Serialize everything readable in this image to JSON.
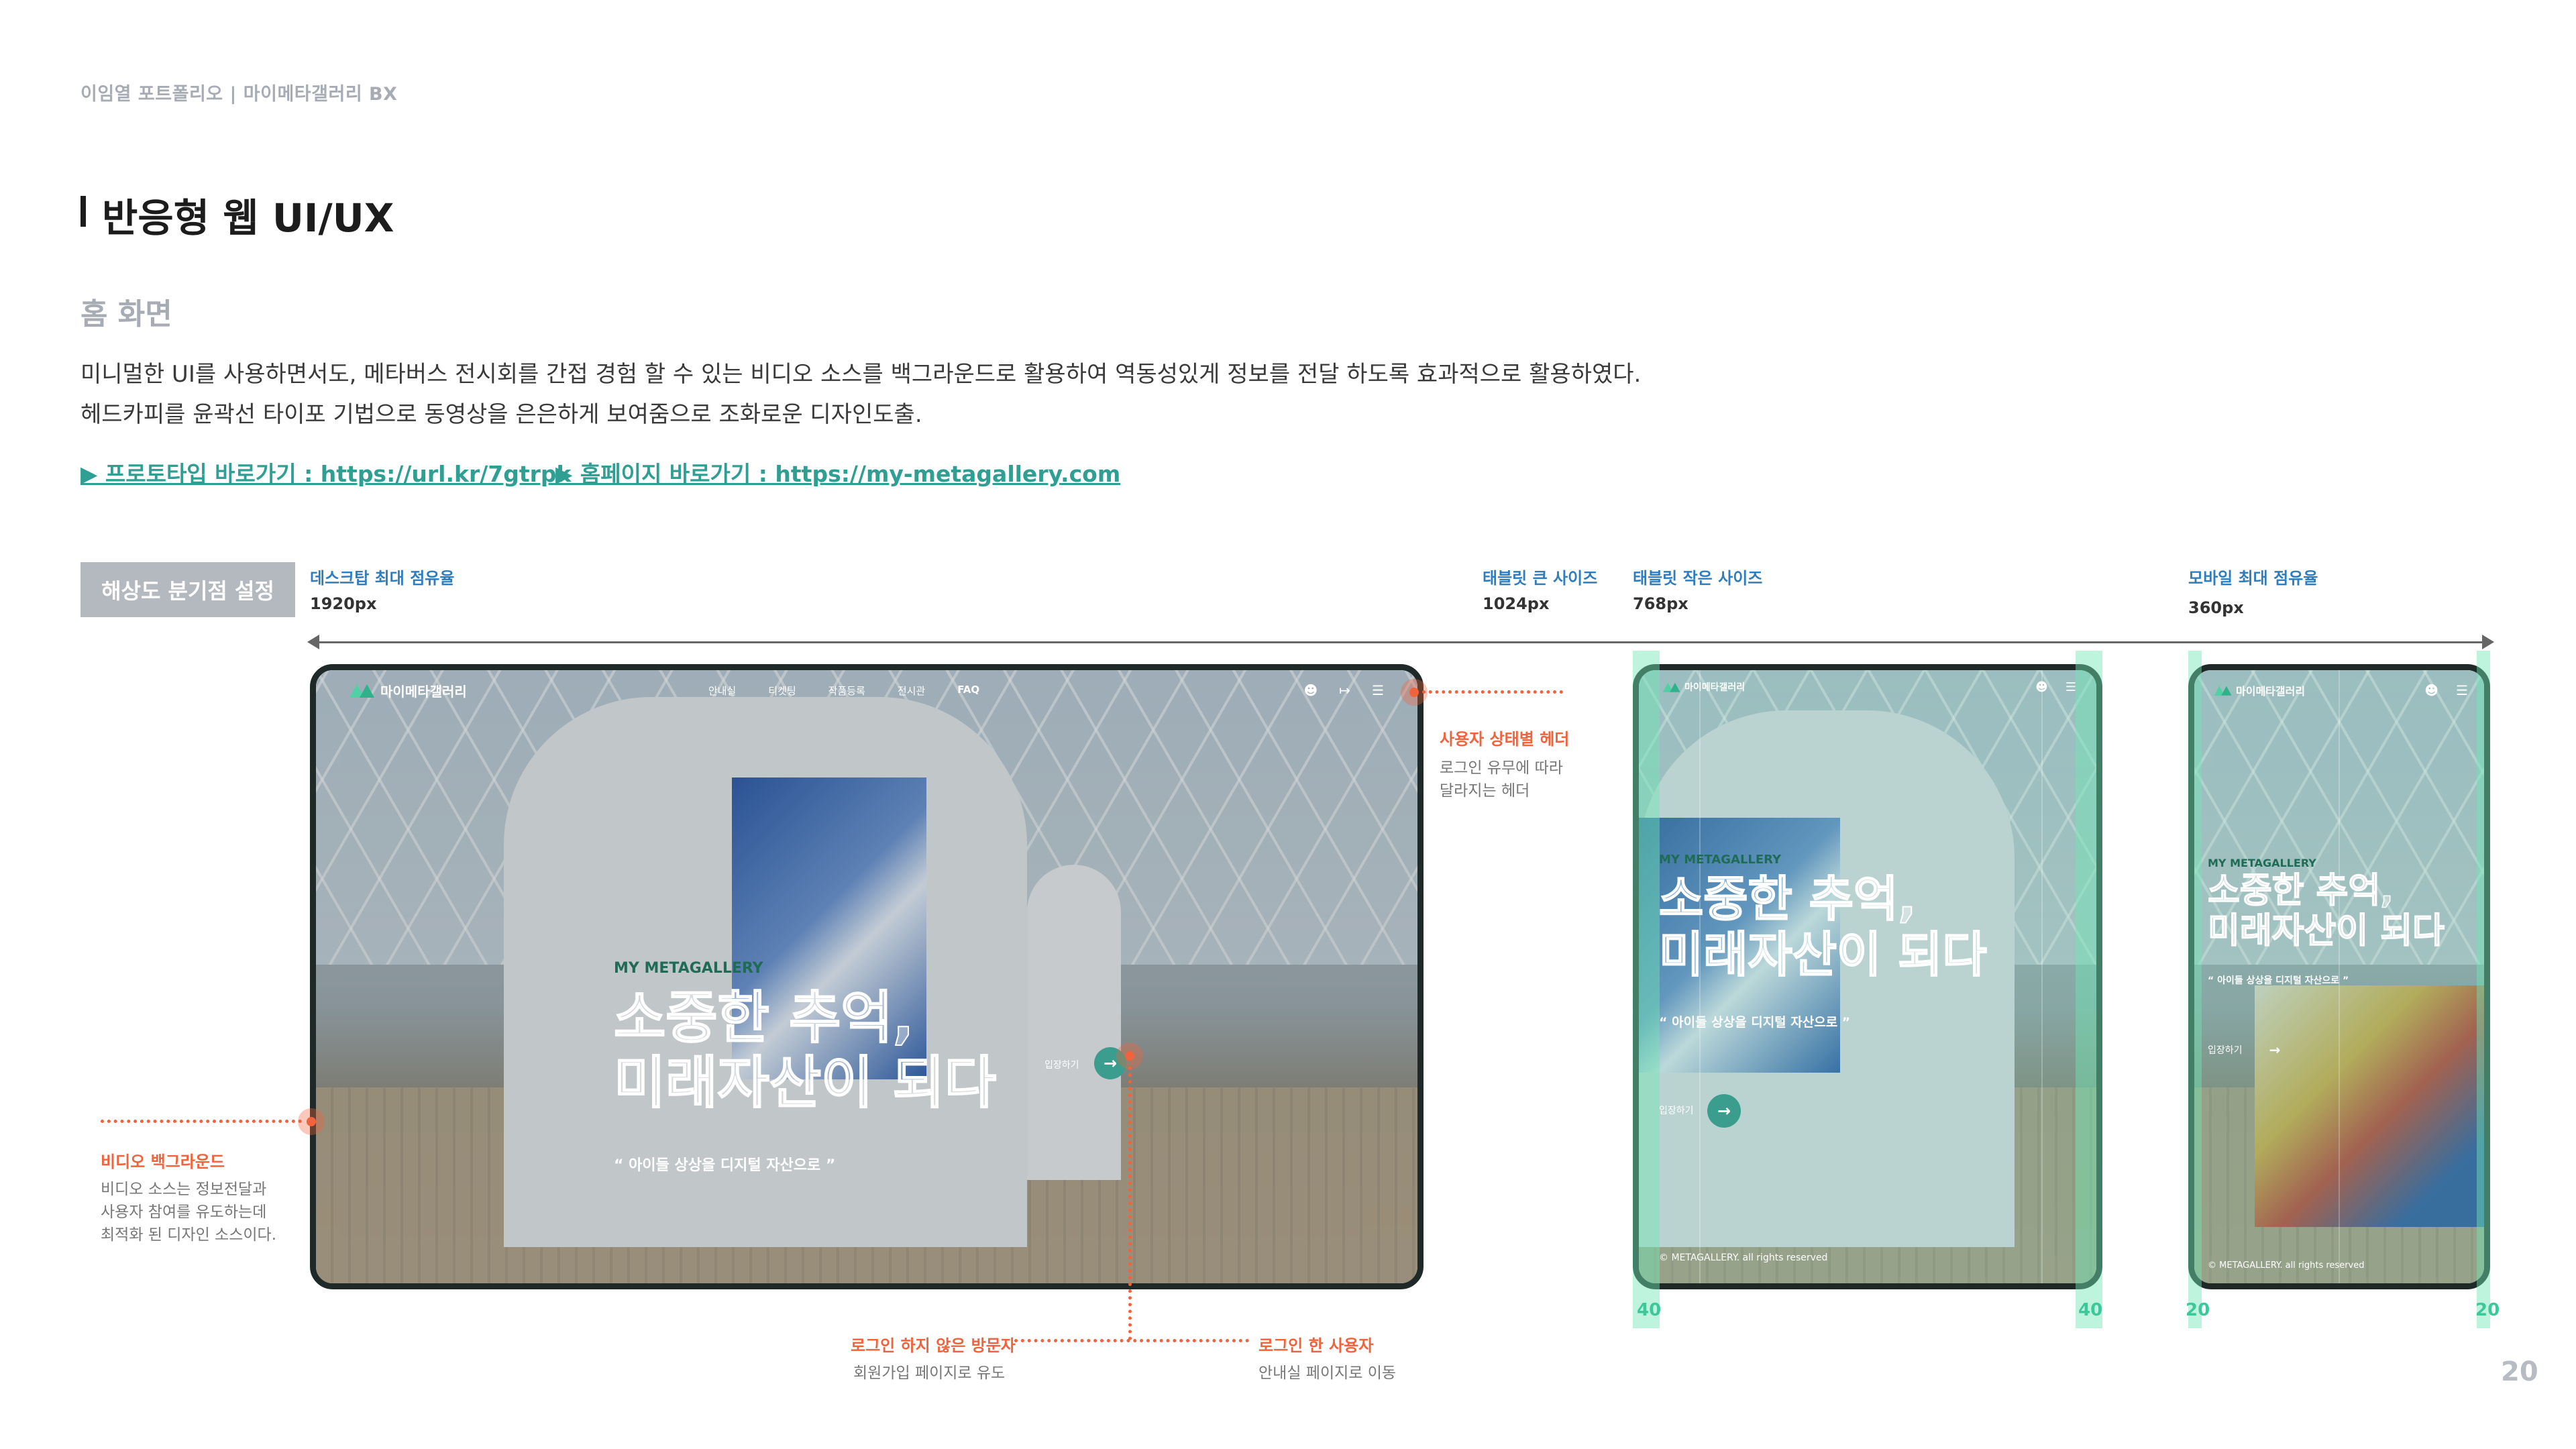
{
  "header": {
    "breadcrumb": "이임열 포트폴리오  |  마이메타갤러리 BX",
    "title": "반응형 웹 UI/UX",
    "subtitle": "홈 화면",
    "desc_line1": "미니멀한 UI를 사용하면서도, 메타버스 전시회를 간접 경험 할 수 있는 비디오 소스를 백그라운드로 활용하여 역동성있게 정보를 전달 하도록 효과적으로 활용하였다.",
    "desc_line2": "헤드카피를 윤곽선 타이포 기법으로 동영상을 은은하게 보여줌으로 조화로운 디자인도출.",
    "link_prototype": "▶ 프로토타입 바로가기 : https://url.kr/7gtrpk",
    "link_homepage": "▶ 홈페이지 바로가기 : https://my-metagallery.com"
  },
  "breakpoints": {
    "label": "해상도 분기점 설정",
    "items": [
      {
        "name": "데스크탑 최대 점유율",
        "size": "1920px"
      },
      {
        "name": "태블릿 큰 사이즈",
        "size": "1024px"
      },
      {
        "name": "태블릿 작은 사이즈",
        "size": "768px"
      },
      {
        "name": "모바일 최대 점유율",
        "size": "360px"
      }
    ]
  },
  "site": {
    "logo": "마이메타갤러리",
    "menu": [
      "안내실",
      "티켓팅",
      "작품등록",
      "전시관",
      "FAQ"
    ],
    "icons": [
      "user-icon",
      "logout-icon",
      "menu-icon"
    ],
    "eyebrow": "MY METAGALLERY",
    "hero_line1": "소중한 추억,",
    "hero_line2": "미래자산이 되다",
    "tagline": "“ 아이들 상상을 디지털 자산으로 ”",
    "enter": "입장하기",
    "copyright": "© METAGALLERY. all rights reserved"
  },
  "margins": {
    "tablet_left": "40",
    "tablet_right": "40",
    "mobile_left": "20",
    "mobile_right": "20"
  },
  "annotations": {
    "header_title": "사용자 상태별 헤더",
    "header_desc1": "로그인 유무에 따라",
    "header_desc2": "달라지는 헤더",
    "video_title": "비디오 백그라운드",
    "video_desc1": "비디오 소스는 정보전달과",
    "video_desc2": "사용자 참여를 유도하는데",
    "video_desc3": "최적화 된 디자인 소스이다.",
    "guest_title": "로그인 하지 않은 방문자",
    "guest_desc": "회원가입 페이지로 유도",
    "member_title": "로그인 한 사용자",
    "member_desc": "안내실 페이지로 이동"
  },
  "colors": {
    "accent_teal": "#2f9f93",
    "annotation_orange": "#f0633c",
    "breakpoint_blue": "#2f7dbd",
    "margin_green": "#3cc89a"
  },
  "page_number": "20"
}
